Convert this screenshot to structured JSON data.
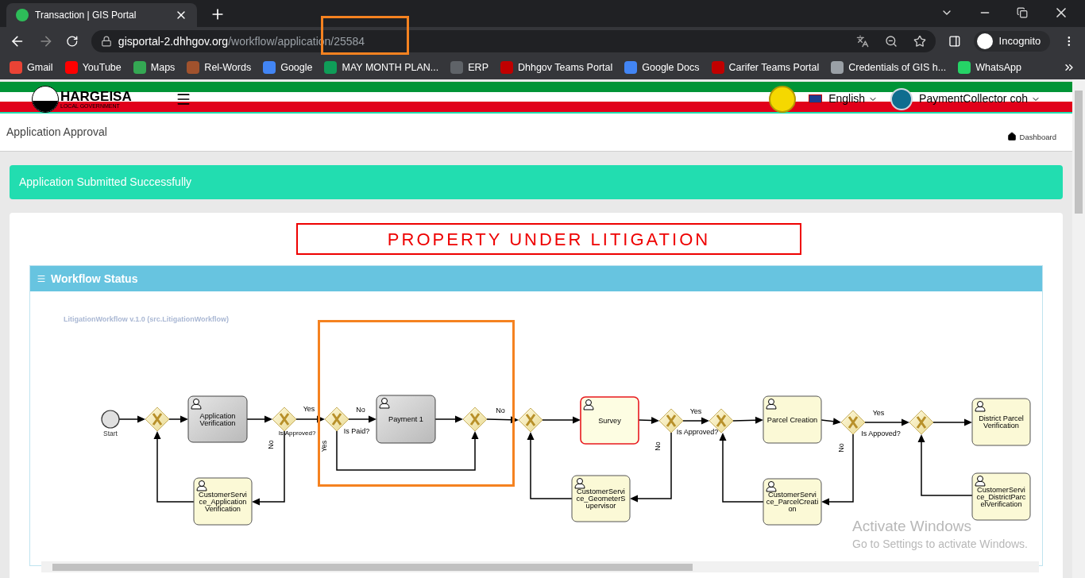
{
  "browser": {
    "tab_title": "Transaction | GIS Portal",
    "url_host": "gisportal-2.dhhgov.org",
    "url_path": "/workflow/application/25584",
    "profile": "Incognito",
    "bookmarks": [
      {
        "label": "Gmail"
      },
      {
        "label": "YouTube"
      },
      {
        "label": "Maps"
      },
      {
        "label": "Rel-Words"
      },
      {
        "label": "Google"
      },
      {
        "label": "MAY MONTH PLAN..."
      },
      {
        "label": "ERP"
      },
      {
        "label": "Dhhgov Teams Portal"
      },
      {
        "label": "Google Docs"
      },
      {
        "label": "Carifer Teams Portal"
      },
      {
        "label": "Credentials of GIS h..."
      },
      {
        "label": "WhatsApp"
      }
    ]
  },
  "header": {
    "logo_title": "HARGEISA",
    "logo_subtitle": "LOCAL GOVERNMENT",
    "language": "English",
    "user": "PaymentCollector coh"
  },
  "page": {
    "title": "Application Approval",
    "breadcrumb": "Dashboard"
  },
  "alert": "Application Submitted Successfully",
  "banner": "PROPERTY UNDER LITIGATION",
  "panel": {
    "title": "Workflow Status",
    "diagram": {
      "caption": "LitigationWorkflow v.1.0 (src.LitigationWorkflow)",
      "start_label": "Start",
      "tasks": [
        {
          "lines": [
            "Application",
            "Verification"
          ],
          "completed": true,
          "active": false
        },
        {
          "lines": [
            "Payment 1"
          ],
          "completed": true,
          "active": false
        },
        {
          "lines": [
            "Survey"
          ],
          "completed": false,
          "active": true
        },
        {
          "lines": [
            "Parcel Creation"
          ],
          "completed": false,
          "active": false
        },
        {
          "lines": [
            "District Parcel",
            "Verification"
          ],
          "completed": false,
          "active": false
        },
        {
          "lines": [
            "CustomerServi",
            "ce_Application",
            "Verification"
          ],
          "completed": false,
          "active": false
        },
        {
          "lines": [
            "CustomerServi",
            "ce_GeometerS",
            "upervisor"
          ],
          "completed": false,
          "active": false
        },
        {
          "lines": [
            "CustomerServi",
            "ce_ParcelCreati",
            "on"
          ],
          "completed": false,
          "active": false
        },
        {
          "lines": [
            "CustomerServi",
            "ce_DistrictParc",
            "elVerification"
          ],
          "completed": false,
          "active": false
        }
      ],
      "edge_labels": [
        "Yes",
        "No",
        "No",
        "Yes",
        "Yes",
        "Is Approved?",
        "Is Paid?",
        "Is Approved?",
        "Is Appoved?",
        "No",
        "Yes",
        "No",
        "No"
      ]
    }
  },
  "os_notice": {
    "title": "Activate Windows",
    "text": "Go to Settings to activate Windows."
  }
}
